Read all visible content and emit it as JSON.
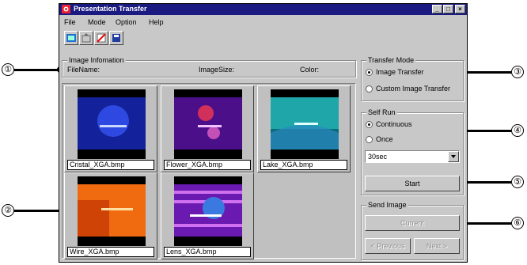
{
  "window": {
    "title": "Presentation Transfer"
  },
  "menu": [
    {
      "label": "File"
    },
    {
      "label": "Mode"
    },
    {
      "label": "Option"
    },
    {
      "label": "Help"
    }
  ],
  "toolbar": [
    "open-icon",
    "upload-icon",
    "delete-icon",
    "save-icon"
  ],
  "image_info": {
    "group_title": "Image Infomation",
    "filename_label": "FileName:",
    "imagesize_label": "ImageSize:",
    "color_label": "Color:"
  },
  "thumbnails": [
    {
      "name": "Cristal_XGA.bmp",
      "colors": [
        "#0e1e8c",
        "#2a3cd4"
      ]
    },
    {
      "name": "Flower_XGA.bmp",
      "colors": [
        "#4b0f8a",
        "#8a1fb5"
      ]
    },
    {
      "name": "Lake_XGA.bmp",
      "colors": [
        "#0b6a7a",
        "#2ab3b0"
      ]
    },
    {
      "name": "Wire_XGA.bmp",
      "colors": [
        "#c73a05",
        "#ff8a10"
      ]
    },
    {
      "name": "Lens_XGA.bmp",
      "colors": [
        "#3a0a8c",
        "#c04be0"
      ]
    }
  ],
  "transfer_mode": {
    "group_title": "Transfer Mode",
    "option1": "Image Transfer",
    "option2": "Custom Image Transfer",
    "selected": "Image Transfer"
  },
  "self_run": {
    "group_title": "Self Run",
    "option1": "Continuous",
    "option2": "Once",
    "selected": "Continuous",
    "interval": "30sec",
    "start_label": "Start"
  },
  "send_image": {
    "group_title": "Send Image",
    "current_label": "Current",
    "previous_label": "< Previous",
    "next_label": "Next >"
  },
  "callouts": [
    "①",
    "②",
    "③",
    "④",
    "⑤",
    "⑥"
  ]
}
